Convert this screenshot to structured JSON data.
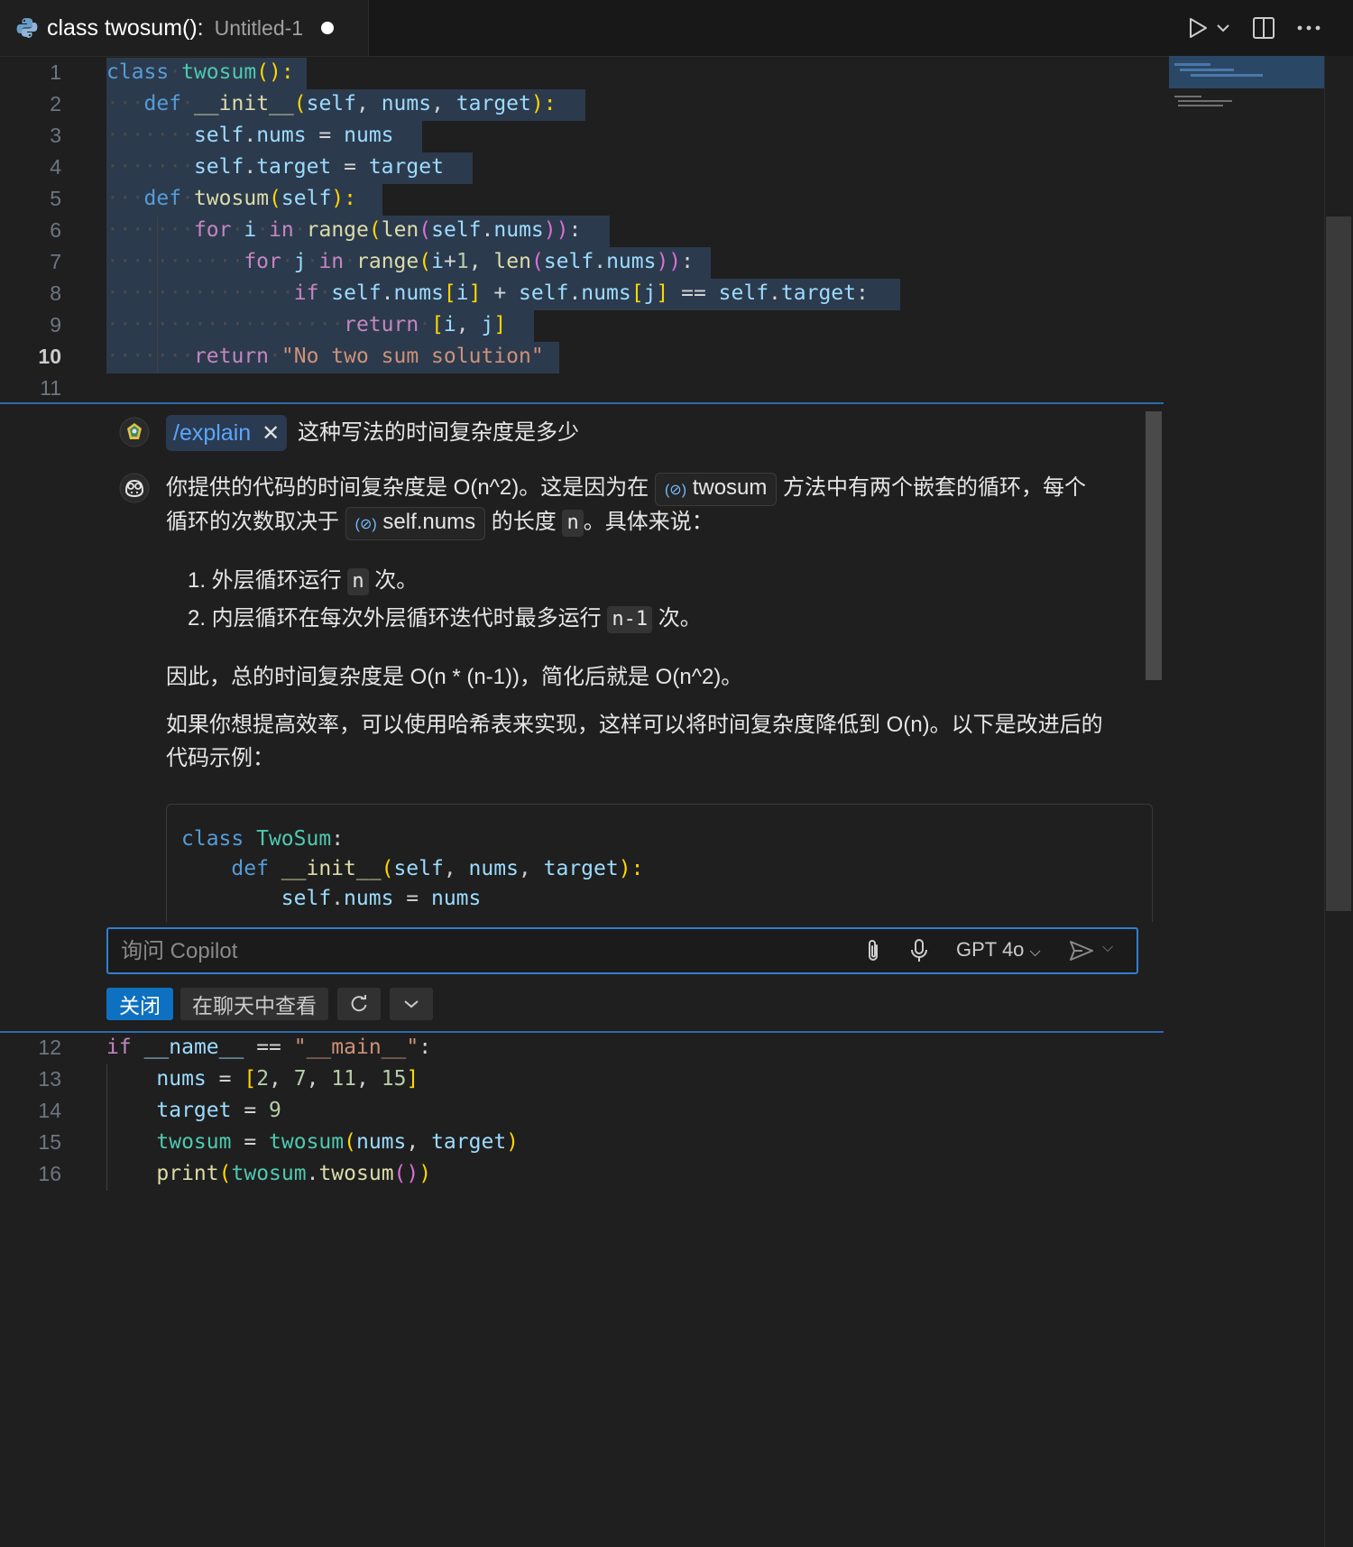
{
  "tab": {
    "title": "class twosum():",
    "subtitle": "Untitled-1"
  },
  "editor": {
    "lines_top": [
      {
        "n": "1"
      },
      {
        "n": "2"
      },
      {
        "n": "3"
      },
      {
        "n": "4"
      },
      {
        "n": "5"
      },
      {
        "n": "6"
      },
      {
        "n": "7"
      },
      {
        "n": "8"
      },
      {
        "n": "9"
      },
      {
        "n": "10"
      },
      {
        "n": "11"
      }
    ],
    "lines_bottom": [
      {
        "n": "12"
      },
      {
        "n": "13"
      },
      {
        "n": "14"
      },
      {
        "n": "15"
      },
      {
        "n": "16"
      }
    ],
    "code": {
      "l1": [
        "class",
        "twosum",
        "():"
      ],
      "l2": [
        "def",
        "__init__",
        "(",
        "self",
        ", ",
        "nums",
        ", ",
        "target",
        "):"
      ],
      "l3": [
        "self",
        ".",
        "nums",
        " = ",
        "nums"
      ],
      "l4": [
        "self",
        ".",
        "target",
        " = ",
        "target"
      ],
      "l5": [
        "def",
        "twosum",
        "(",
        "self",
        "):"
      ],
      "l6": [
        "for",
        "i",
        "in",
        "range",
        "(",
        "len",
        "(",
        "self",
        ".",
        "nums",
        "))",
        ":"
      ],
      "l7": [
        "for",
        "j",
        "in",
        "range",
        "(",
        "i",
        "+",
        "1",
        ", ",
        "len",
        "(",
        "self",
        ".",
        "nums",
        "))",
        ":"
      ],
      "l8": [
        "if",
        "self",
        ".",
        "nums",
        "[",
        "i",
        "]",
        " + ",
        "self",
        ".",
        "nums",
        "[",
        "j",
        "]",
        " == ",
        "self",
        ".",
        "target",
        ":"
      ],
      "l9": [
        "return",
        "[",
        "i",
        ", ",
        "j",
        "]"
      ],
      "l10": [
        "return",
        "\"No two sum solution\""
      ],
      "l12": [
        "if",
        "__name__",
        " == ",
        "\"__main__\"",
        ":"
      ],
      "l13": [
        "nums",
        " = ",
        "[",
        "2",
        ", ",
        "7",
        ", ",
        "11",
        ", ",
        "15",
        "]"
      ],
      "l14": [
        "target",
        " = ",
        "9"
      ],
      "l15": [
        "twosum",
        " = ",
        "twosum",
        "(",
        "nums",
        ", ",
        "target",
        ")"
      ],
      "l16": [
        "print",
        "(",
        "twosum",
        ".",
        "twosum",
        "()",
        ")"
      ]
    }
  },
  "chat": {
    "command": "/explain",
    "question": "这种写法的时间复杂度是多少",
    "answer_p1_a": "你提供的代码的时间复杂度是 O(n^2)。这是因为在",
    "ref_twosum": "twosum",
    "answer_p1_b": "方法中有两个嵌套的循环，每个",
    "answer_p1_c": "循环的次数取决于",
    "ref_selfnums": "self.nums",
    "answer_p1_d": "的长度",
    "inline_n": "n",
    "answer_p1_e": "。具体来说：",
    "list1_a": "1. 外层循环运行",
    "list1_n": "n",
    "list1_b": "次。",
    "list2_a": "2. 内层循环在每次外层循环迭代时最多运行",
    "list2_n": "n-1",
    "list2_b": "次。",
    "p2": "因此，总的时间复杂度是 O(n * (n-1))，简化后就是 O(n^2)。",
    "p3_a": "如果你想提高效率，可以使用哈希表来实现，这样可以将时间复杂度降低到 O(n)。以下是改进后的",
    "p3_b": "代码示例：",
    "codeblock": {
      "c1": [
        "class",
        "TwoSum",
        ":"
      ],
      "c2": [
        "def",
        "__init__",
        "(",
        "self",
        ", ",
        "nums",
        ", ",
        "target",
        "):"
      ],
      "c3": [
        "self",
        ".",
        "nums",
        " = ",
        "nums"
      ]
    },
    "input_placeholder": "询问 Copilot",
    "model": "GPT 4o",
    "close_label": "关闭",
    "view_in_chat_label": "在聊天中查看"
  }
}
